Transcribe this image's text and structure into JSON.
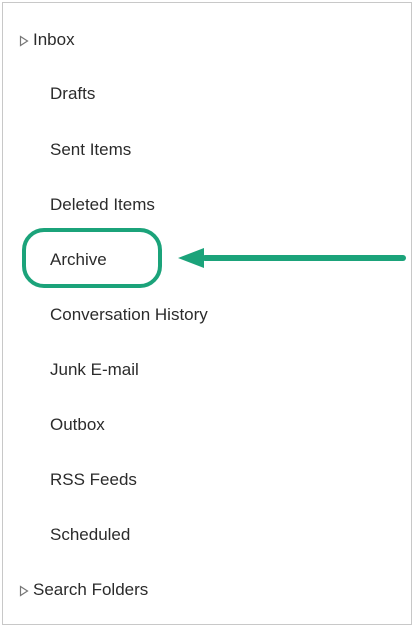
{
  "folders": [
    {
      "label": "Inbox",
      "expandable": true
    },
    {
      "label": "Drafts",
      "expandable": false
    },
    {
      "label": "Sent Items",
      "expandable": false
    },
    {
      "label": "Deleted Items",
      "expandable": false
    },
    {
      "label": "Archive",
      "expandable": false,
      "highlighted": true
    },
    {
      "label": "Conversation History",
      "expandable": false
    },
    {
      "label": "Junk E-mail",
      "expandable": false
    },
    {
      "label": "Outbox",
      "expandable": false
    },
    {
      "label": "RSS Feeds",
      "expandable": false
    },
    {
      "label": "Scheduled",
      "expandable": false
    },
    {
      "label": "Search Folders",
      "expandable": true
    }
  ],
  "annotation": {
    "color": "#1ba37a",
    "arrow_target": "Archive"
  }
}
